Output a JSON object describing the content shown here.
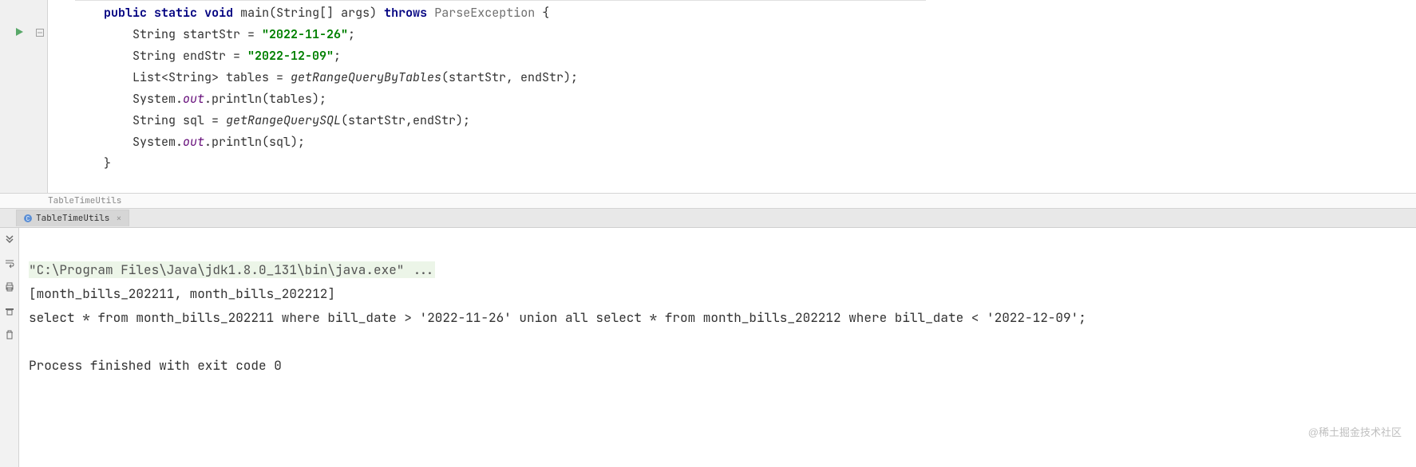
{
  "editor": {
    "breadcrumb": "TableTimeUtils",
    "lines": {
      "l1": {
        "pre": "    ",
        "kw1": "public",
        "kw2": "static",
        "kw3": "void",
        "fn": "main",
        "args": "(String[] args)",
        "kw4": "throws",
        "exc": "ParseException",
        "brace": " {"
      },
      "l2": {
        "pre": "        ",
        "lhs": "String startStr = ",
        "str": "\"2022-11-26\"",
        "tail": ";"
      },
      "l3": {
        "pre": "        ",
        "lhs": "String endStr = ",
        "str": "\"2022-12-09\"",
        "tail": ";"
      },
      "l4": {
        "pre": "        ",
        "lhs": "List<String> tables = ",
        "fn": "getRangeQueryByTables",
        "args": "(startStr, endStr);"
      },
      "l5": {
        "pre": "        ",
        "obj": "System.",
        "stf": "out",
        "fn": ".println(tables);"
      },
      "l6": {
        "pre": "        ",
        "lhs": "String sql = ",
        "fn": "getRangeQuerySQL",
        "args": "(startStr,endStr);"
      },
      "l7": {
        "pre": "        ",
        "obj": "System.",
        "stf": "out",
        "fn": ".println(sql);"
      },
      "l8": {
        "text": "    }"
      }
    }
  },
  "run": {
    "tab_label": "TableTimeUtils",
    "console": {
      "cmd": "\"C:\\Program Files\\Java\\jdk1.8.0_131\\bin\\java.exe\" ...",
      "out1": "[month_bills_202211, month_bills_202212]",
      "out2": "select * from month_bills_202211 where bill_date > '2022-11-26' union all select * from month_bills_202212 where bill_date < '2022-12-09';",
      "blank": "",
      "exit": "Process finished with exit code 0"
    }
  },
  "watermark": "@稀土掘金技术社区"
}
